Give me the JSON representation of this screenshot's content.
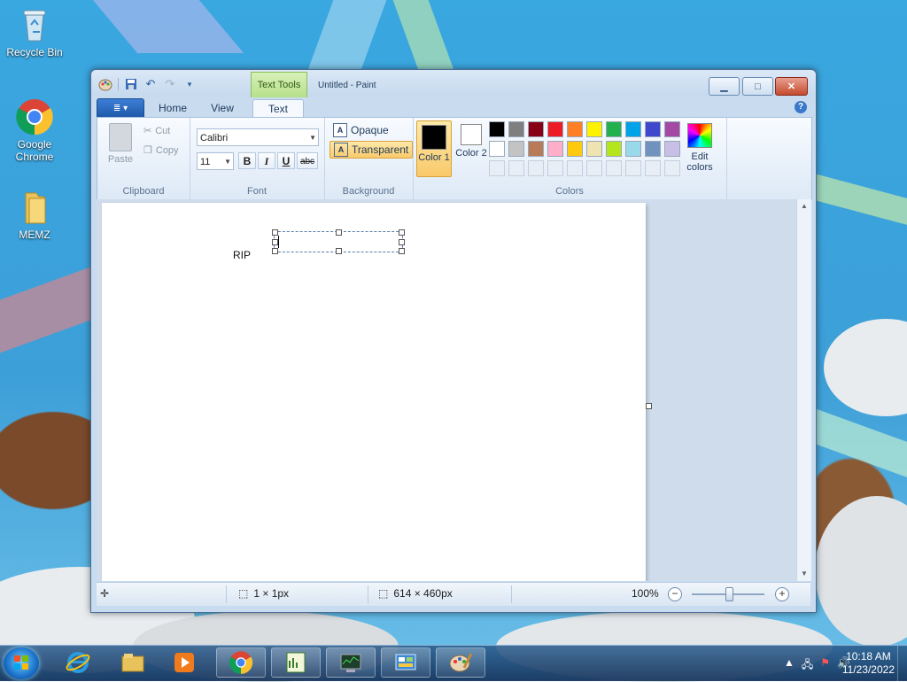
{
  "desktop": {
    "icons": [
      {
        "label": "Recycle Bin",
        "icon": "recycle-bin-icon"
      },
      {
        "label": "Google Chrome",
        "icon": "chrome-icon"
      },
      {
        "label": "MEMZ",
        "icon": "folder-icon"
      }
    ]
  },
  "window": {
    "title": "Untitled - Paint",
    "context_tab": "Text Tools",
    "controls": {
      "minimize": "▁",
      "maximize": "□",
      "close": "✕"
    }
  },
  "ribbon": {
    "app_button": "≣ ▾",
    "tabs": [
      {
        "label": "Home",
        "active": false
      },
      {
        "label": "View",
        "active": false
      },
      {
        "label": "Text",
        "active": true
      }
    ],
    "help": "?",
    "clipboard": {
      "paste": "Paste",
      "cut": "Cut",
      "copy": "Copy",
      "group_label": "Clipboard"
    },
    "font": {
      "family": "Calibri",
      "size": "11",
      "bold": "B",
      "italic": "I",
      "underline": "U",
      "strikethrough": "abc",
      "group_label": "Font"
    },
    "background": {
      "opaque": "Opaque",
      "transparent": "Transparent",
      "selected": "transparent",
      "group_label": "Background"
    },
    "colors": {
      "color1_label": "Color 1",
      "color1": "#000000",
      "color2_label": "Color 2",
      "color2": "#ffffff",
      "edit_label": "Edit colors",
      "group_label": "Colors",
      "palette": [
        "#000000",
        "#7f7f7f",
        "#880015",
        "#ed1c24",
        "#ff7f27",
        "#fff200",
        "#22b14c",
        "#00a2e8",
        "#3f48cc",
        "#a349a4",
        "#ffffff",
        "#c3c3c3",
        "#b97a57",
        "#ffaec9",
        "#ffc90e",
        "#efe4b0",
        "#b5e61d",
        "#99d9ea",
        "#7092be",
        "#c8bfe7"
      ],
      "empty_slots": 10
    }
  },
  "canvas": {
    "text": "RIP"
  },
  "status": {
    "selection_size": "1 × 1px",
    "image_size": "614 × 460px",
    "zoom": "100%",
    "zoom_fraction": 0.5
  },
  "taskbar": {
    "clock_time": "10:18 AM",
    "clock_date": "11/23/2022",
    "items": [
      "internet-explorer-icon",
      "file-explorer-icon",
      "media-player-icon",
      "chrome-icon",
      "notepad-chart-icon",
      "task-manager-icon",
      "control-panel-icon",
      "paint-icon"
    ]
  }
}
